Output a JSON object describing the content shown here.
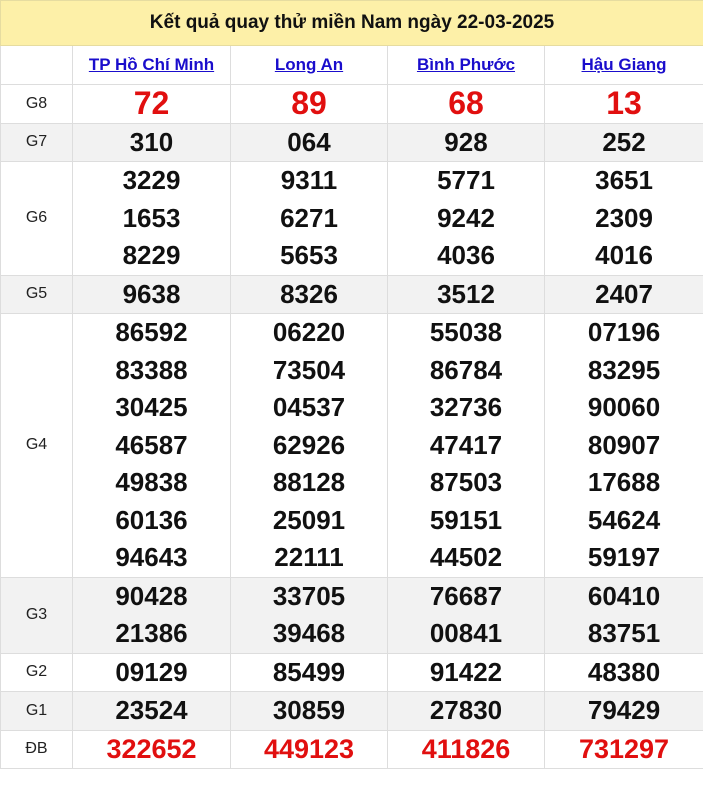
{
  "title": "Kết quả quay thử miền Nam ngày 22-03-2025",
  "provinces": [
    "TP Hồ Chí Minh",
    "Long An",
    "Bình Phước",
    "Hậu Giang"
  ],
  "colors": {
    "title_bg": "#fdf0a8",
    "link": "#1a0dcc",
    "highlight_red": "#e10f0f",
    "row_shade": "#f2f2f2"
  },
  "prizes": [
    {
      "label": "G8",
      "values": [
        [
          "72"
        ],
        [
          "89"
        ],
        [
          "68"
        ],
        [
          "13"
        ]
      ]
    },
    {
      "label": "G7",
      "values": [
        [
          "310"
        ],
        [
          "064"
        ],
        [
          "928"
        ],
        [
          "252"
        ]
      ]
    },
    {
      "label": "G6",
      "values": [
        [
          "3229",
          "1653",
          "8229"
        ],
        [
          "9311",
          "6271",
          "5653"
        ],
        [
          "5771",
          "9242",
          "4036"
        ],
        [
          "3651",
          "2309",
          "4016"
        ]
      ]
    },
    {
      "label": "G5",
      "values": [
        [
          "9638"
        ],
        [
          "8326"
        ],
        [
          "3512"
        ],
        [
          "2407"
        ]
      ]
    },
    {
      "label": "G4",
      "values": [
        [
          "86592",
          "83388",
          "30425",
          "46587",
          "49838",
          "60136",
          "94643"
        ],
        [
          "06220",
          "73504",
          "04537",
          "62926",
          "88128",
          "25091",
          "22111"
        ],
        [
          "55038",
          "86784",
          "32736",
          "47417",
          "87503",
          "59151",
          "44502"
        ],
        [
          "07196",
          "83295",
          "90060",
          "80907",
          "17688",
          "54624",
          "59197"
        ]
      ]
    },
    {
      "label": "G3",
      "values": [
        [
          "90428",
          "21386"
        ],
        [
          "33705",
          "39468"
        ],
        [
          "76687",
          "00841"
        ],
        [
          "60410",
          "83751"
        ]
      ]
    },
    {
      "label": "G2",
      "values": [
        [
          "09129"
        ],
        [
          "85499"
        ],
        [
          "91422"
        ],
        [
          "48380"
        ]
      ]
    },
    {
      "label": "G1",
      "values": [
        [
          "23524"
        ],
        [
          "30859"
        ],
        [
          "27830"
        ],
        [
          "79429"
        ]
      ]
    },
    {
      "label": "ĐB",
      "values": [
        [
          "322652"
        ],
        [
          "449123"
        ],
        [
          "411826"
        ],
        [
          "731297"
        ]
      ]
    }
  ]
}
